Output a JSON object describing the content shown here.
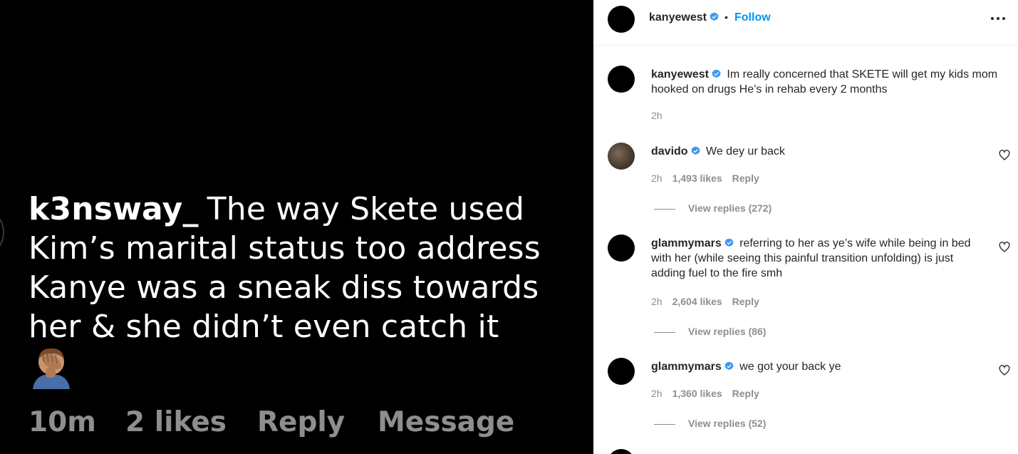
{
  "media": {
    "comment_user": "k3nsway_",
    "comment_text": "The way Skete used Kim’s marital status too address Kanye was a sneak diss towards her & she didn’t even catch it",
    "emoji": "facepalm-emoji",
    "time": "10m",
    "likes": "2 likes",
    "reply": "Reply",
    "message": "Message"
  },
  "header": {
    "username": "kanyewest",
    "dot": "•",
    "follow": "Follow"
  },
  "caption": {
    "username": "kanyewest",
    "text": "Im really concerned that SKETE will get my kids mom hooked on drugs He’s in rehab every 2 months",
    "time": "2h"
  },
  "comments": [
    {
      "username": "davido",
      "text": "We dey ur back",
      "time": "2h",
      "likes": "1,493 likes",
      "reply": "Reply",
      "view_replies": "View replies (272)"
    },
    {
      "username": "glammymars",
      "text": "referring to her as ye’s wife while being in bed with her (while seeing this painful transition unfolding) is just adding fuel to the fire smh",
      "time": "2h",
      "likes": "2,604 likes",
      "reply": "Reply",
      "view_replies": "View replies (86)"
    },
    {
      "username": "glammymars",
      "text": "we got your back ye",
      "time": "2h",
      "likes": "1,360 likes",
      "reply": "Reply",
      "view_replies": "View replies (52)"
    }
  ],
  "colors": {
    "accent": "#0095f6",
    "verified": "#3897f0",
    "muted": "#8e8e8e",
    "text": "#262626"
  }
}
